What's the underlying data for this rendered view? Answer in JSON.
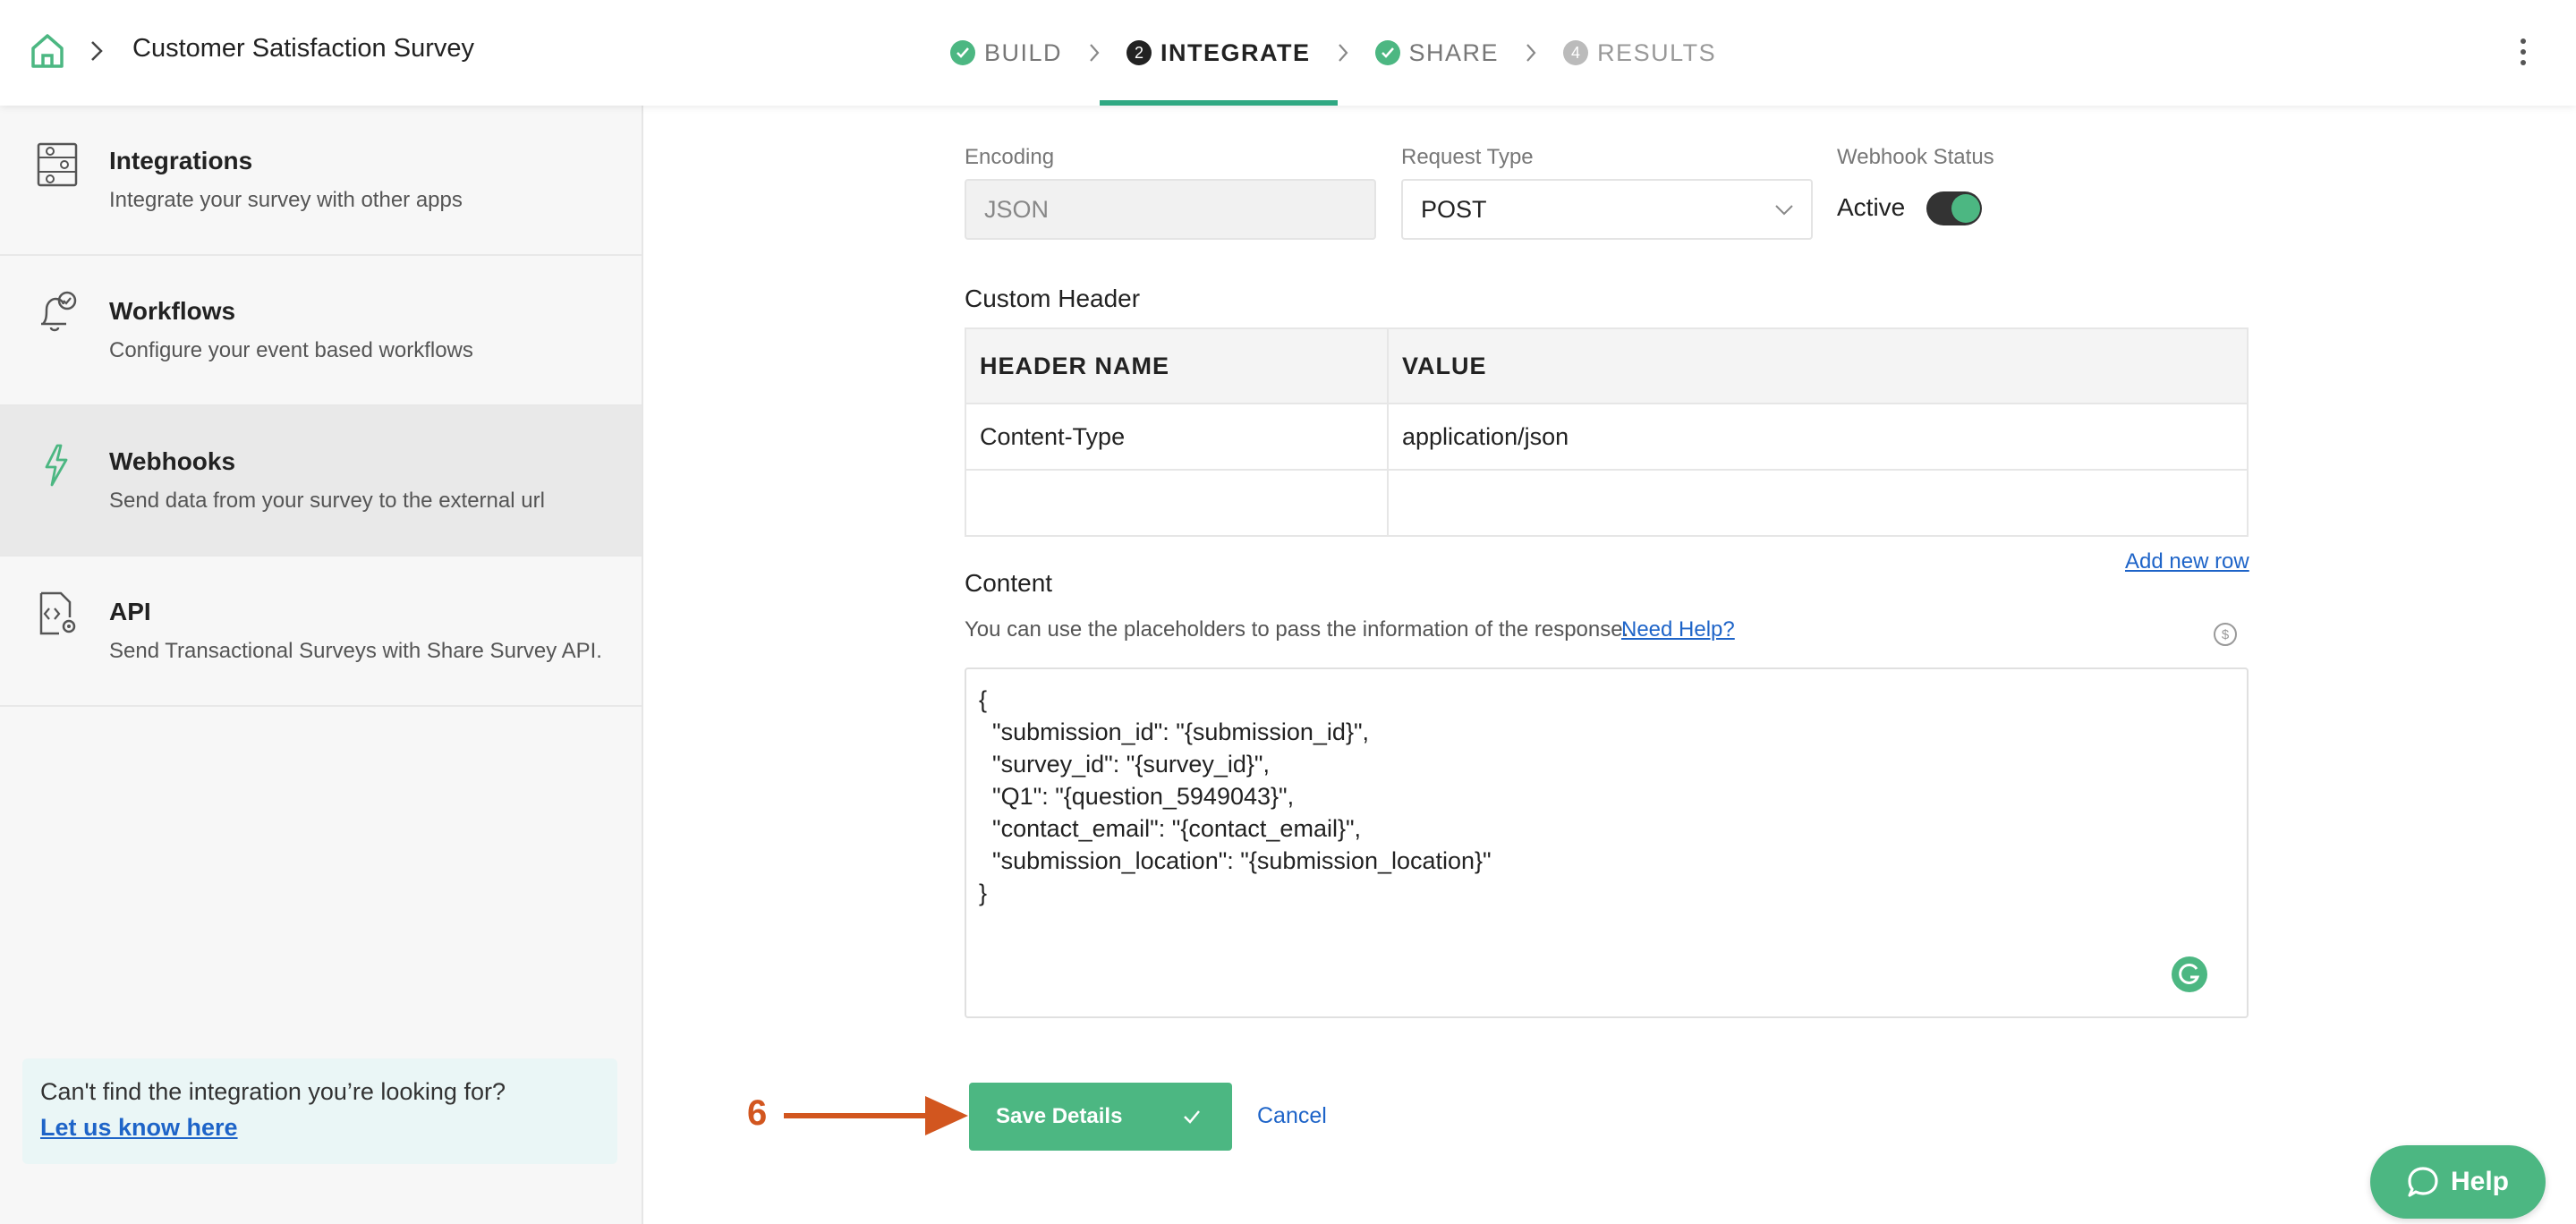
{
  "header": {
    "survey_title": "Customer Satisfaction Survey",
    "steps": [
      {
        "label": "BUILD",
        "badge": "",
        "state": "done"
      },
      {
        "label": "INTEGRATE",
        "badge": "2",
        "state": "active"
      },
      {
        "label": "SHARE",
        "badge": "",
        "state": "done"
      },
      {
        "label": "RESULTS",
        "badge": "4",
        "state": "todo"
      }
    ]
  },
  "sidebar": {
    "items": [
      {
        "title": "Integrations",
        "desc": "Integrate your survey with other apps",
        "icon": "sliders-icon"
      },
      {
        "title": "Workflows",
        "desc": "Configure your event based workflows",
        "icon": "bell-check-icon"
      },
      {
        "title": "Webhooks",
        "desc": "Send data from your survey to the external url",
        "icon": "lightning-icon"
      },
      {
        "title": "API",
        "desc": "Send Transactional Surveys with Share Survey API.",
        "icon": "code-gear-icon"
      }
    ],
    "help_box": {
      "question": "Can't find the integration you’re looking for?",
      "link": "Let us know here"
    }
  },
  "form": {
    "encoding": {
      "label": "Encoding",
      "value": "JSON"
    },
    "request_type": {
      "label": "Request Type",
      "value": "POST"
    },
    "webhook_status": {
      "label": "Webhook Status",
      "value": "Active",
      "enabled": true
    },
    "custom_header": {
      "title": "Custom Header",
      "columns": [
        "HEADER NAME",
        "VALUE"
      ],
      "rows": [
        [
          "Content-Type",
          "application/json"
        ],
        [
          "",
          ""
        ]
      ],
      "add_row": "Add new row"
    },
    "content": {
      "title": "Content",
      "description": "You can use the placeholders to pass the information of the response.",
      "help_link": "Need Help?",
      "body": "{\n  \"submission_id\": \"{submission_id}\",\n  \"survey_id\": \"{survey_id}\",\n  \"Q1\": \"{question_5949043}\",\n  \"contact_email\": \"{contact_email}\",\n  \"submission_location\": \"{submission_location}\"\n}"
    }
  },
  "actions": {
    "annotation_number": "6",
    "save_label": "Save Details",
    "cancel_label": "Cancel",
    "help_label": "Help"
  },
  "colors": {
    "accent": "#4cb782",
    "link": "#1e64c8",
    "annotation": "#d2561f"
  }
}
